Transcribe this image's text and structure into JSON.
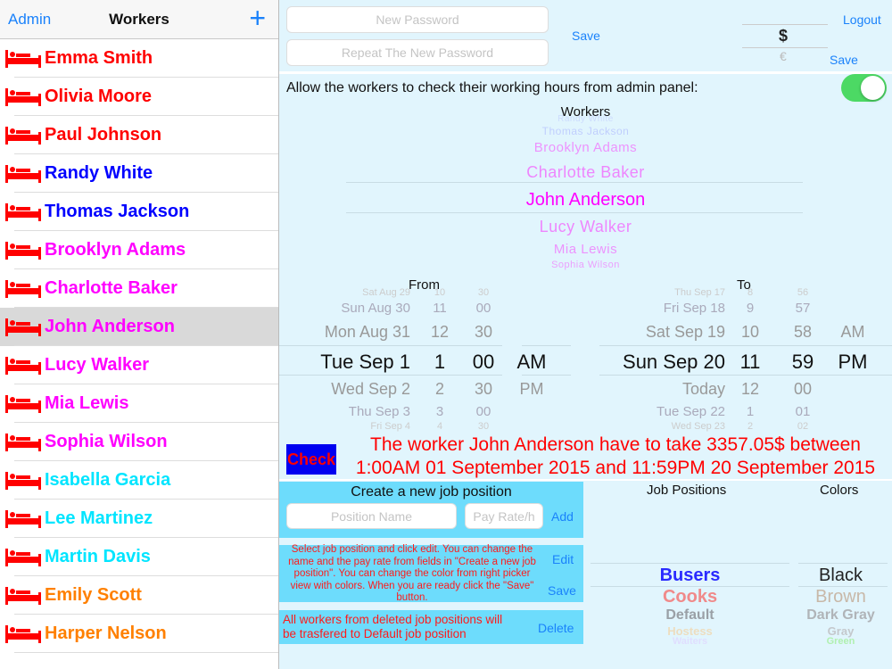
{
  "nav": {
    "back": "Admin",
    "title": "Workers",
    "add": "+"
  },
  "workers": [
    {
      "name": "Emma Smith",
      "color": "#ff0000"
    },
    {
      "name": "Olivia Moore",
      "color": "#ff0000"
    },
    {
      "name": "Paul Johnson",
      "color": "#ff0000"
    },
    {
      "name": "Randy White",
      "color": "#0000ff"
    },
    {
      "name": "Thomas Jackson",
      "color": "#0000ff"
    },
    {
      "name": "Brooklyn Adams",
      "color": "#ff00ff"
    },
    {
      "name": "Charlotte Baker",
      "color": "#ff00ff"
    },
    {
      "name": "John Anderson",
      "color": "#ff00ff",
      "selected": true
    },
    {
      "name": "Lucy Walker",
      "color": "#ff00ff"
    },
    {
      "name": "Mia Lewis",
      "color": "#ff00ff"
    },
    {
      "name": "Sophia Wilson",
      "color": "#ff00ff"
    },
    {
      "name": "Isabella Garcia",
      "color": "#00e5ff"
    },
    {
      "name": "Lee Martinez",
      "color": "#00e5ff"
    },
    {
      "name": "Martin Davis",
      "color": "#00e5ff"
    },
    {
      "name": "Emily Scott",
      "color": "#ff8000"
    },
    {
      "name": "Harper Nelson",
      "color": "#ff8000"
    }
  ],
  "password": {
    "new_placeholder": "New Password",
    "repeat_placeholder": "Repeat The New Password",
    "save": "Save"
  },
  "currency": {
    "options": [
      "$",
      "€"
    ],
    "save": "Save"
  },
  "logout": "Logout",
  "allow_label": "Allow the workers to check their working hours from admin panel:",
  "allow_on": true,
  "worker_picker": {
    "title": "Workers",
    "items": [
      "Randy White",
      "Thomas Jackson",
      "Brooklyn Adams",
      "Charlotte Baker",
      "John Anderson",
      "Lucy Walker",
      "Mia Lewis",
      "Sophia Wilson"
    ],
    "selected": "John Anderson"
  },
  "from": {
    "title": "From",
    "dates": [
      "Sat Aug 29",
      "Sun Aug 30",
      "Mon Aug 31",
      "Tue Sep 1",
      "Wed Sep 2",
      "Thu Sep 3",
      "Fri Sep 4"
    ],
    "hours": [
      "10",
      "11",
      "12",
      "1",
      "2",
      "3",
      "4"
    ],
    "minutes": [
      "30",
      "00",
      "30",
      "00",
      "30",
      "00",
      "30"
    ],
    "ampm": [
      "AM",
      "PM"
    ]
  },
  "to": {
    "title": "To",
    "dates": [
      "Thu Sep 17",
      "Fri Sep 18",
      "Sat Sep 19",
      "Sun Sep 20",
      "Today",
      "Tue Sep 22",
      "Wed Sep 23"
    ],
    "hours": [
      "8",
      "9",
      "10",
      "11",
      "12",
      "1",
      "2"
    ],
    "minutes": [
      "56",
      "57",
      "58",
      "59",
      "00",
      "01",
      "02"
    ],
    "ampm": [
      "AM",
      "PM"
    ]
  },
  "check": {
    "button": "Check",
    "result_line1": "The worker John Anderson have to take 3357.05$ between",
    "result_line2": "1:00AM 01 September 2015 and 11:59PM 20 September 2015"
  },
  "create_job": {
    "title": "Create a new job position",
    "name_placeholder": "Position Name",
    "rate_placeholder": "Pay Rate/h",
    "add": "Add"
  },
  "edit_job": {
    "text": "Select job position and click edit. You can change the name and the pay rate from fields in \"Create a new job position\". You can change the color from right picker view with colors. When you are ready click the \"Save\" button.",
    "edit": "Edit",
    "save": "Save"
  },
  "delete_job": {
    "text": "All workers from deleted job positions will be trasfered to Default job position",
    "delete": "Delete"
  },
  "job_positions": {
    "title": "Job Positions",
    "items": [
      {
        "name": "Busers",
        "color": "#2a2aff"
      },
      {
        "name": "Cooks",
        "color": "#f08a8a"
      },
      {
        "name": "Default",
        "color": "#9aa0a6"
      },
      {
        "name": "Hostess",
        "color": "#f0d8b0"
      },
      {
        "name": "Waiters",
        "color": "#e0d0ff"
      }
    ]
  },
  "colors": {
    "title": "Colors",
    "items": [
      "Black",
      "Brown",
      "Dark Gray",
      "Gray",
      "Green"
    ]
  }
}
